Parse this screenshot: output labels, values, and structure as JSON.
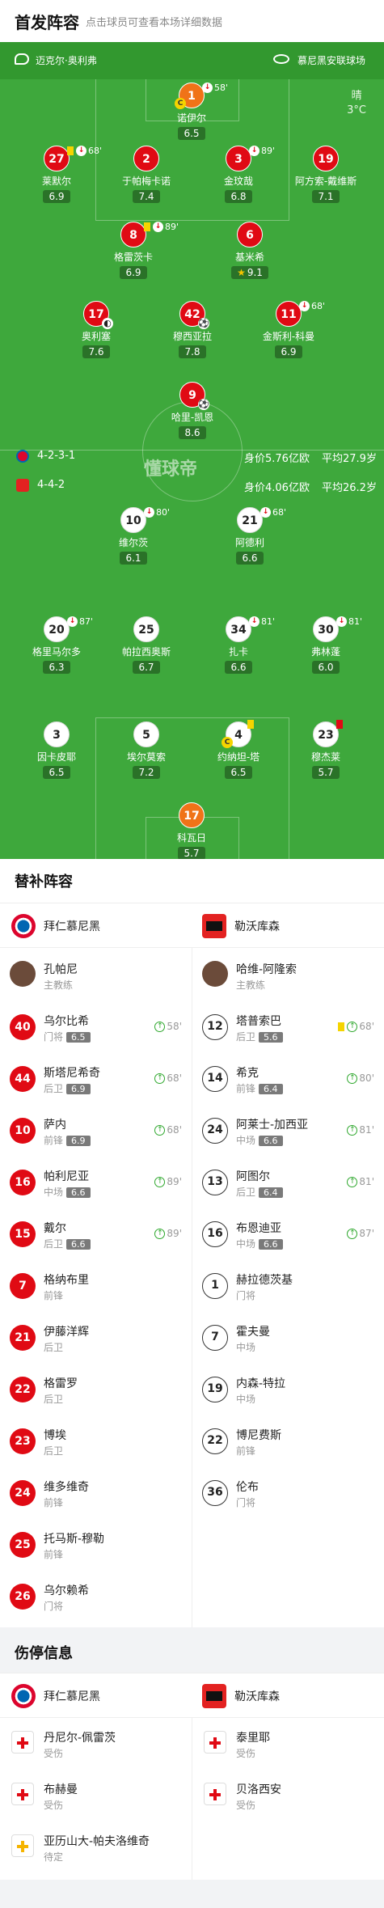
{
  "header": {
    "title": "首发阵容",
    "subtitle": "点击球员可查看本场详细数据"
  },
  "pitch": {
    "referee": "迈克尔·奥利弗",
    "stadium": "慕尼黑安联球场",
    "weather": "晴",
    "temperature": "3°C",
    "watermark": "懂球帝",
    "home_formation": "4-2-3-1",
    "away_formation": "4-4-2",
    "home_value": "身价5.76亿欧",
    "home_age": "平均27.9岁",
    "away_value": "身价4.06亿欧",
    "away_age": "平均26.2岁"
  },
  "home_players": [
    {
      "num": "1",
      "name": "诺伊尔",
      "rating": "6.5",
      "sub": "58'",
      "captain": "C"
    },
    {
      "num": "27",
      "name": "莱默尔",
      "rating": "6.9",
      "sub": "68'"
    },
    {
      "num": "2",
      "name": "于帕梅卡诺",
      "rating": "7.4"
    },
    {
      "num": "3",
      "name": "金玟哉",
      "rating": "6.8",
      "sub": "89'"
    },
    {
      "num": "19",
      "name": "阿方索-戴维斯",
      "rating": "7.1"
    },
    {
      "num": "8",
      "name": "格雷茨卡",
      "rating": "6.9",
      "sub": "89'"
    },
    {
      "num": "6",
      "name": "基米希",
      "rating": "9.1"
    },
    {
      "num": "17",
      "name": "奥利塞",
      "rating": "7.6"
    },
    {
      "num": "42",
      "name": "穆西亚拉",
      "rating": "7.8"
    },
    {
      "num": "11",
      "name": "金斯利-科曼",
      "rating": "6.9",
      "sub": "68'"
    },
    {
      "num": "9",
      "name": "哈里-凯恩",
      "rating": "8.6"
    }
  ],
  "away_players": [
    {
      "num": "10",
      "name": "维尔茨",
      "rating": "6.1",
      "sub": "80'"
    },
    {
      "num": "21",
      "name": "阿德利",
      "rating": "6.6",
      "sub": "68'"
    },
    {
      "num": "20",
      "name": "格里马尔多",
      "rating": "6.3",
      "sub": "87'"
    },
    {
      "num": "25",
      "name": "帕拉西奥斯",
      "rating": "6.7"
    },
    {
      "num": "34",
      "name": "扎卡",
      "rating": "6.6",
      "sub": "81'"
    },
    {
      "num": "30",
      "name": "弗林蓬",
      "rating": "6.0",
      "sub": "81'"
    },
    {
      "num": "3",
      "name": "因卡皮耶",
      "rating": "6.5"
    },
    {
      "num": "5",
      "name": "埃尔莫索",
      "rating": "7.2"
    },
    {
      "num": "4",
      "name": "约纳坦-塔",
      "rating": "6.5",
      "captain": "C"
    },
    {
      "num": "23",
      "name": "穆杰莱",
      "rating": "5.7"
    },
    {
      "num": "17",
      "name": "科瓦日",
      "rating": "5.7"
    }
  ],
  "subs": {
    "title": "替补阵容",
    "home_team": "拜仁慕尼黑",
    "away_team": "勒沃库森",
    "home_coach": {
      "name": "孔帕尼",
      "role": "主教练"
    },
    "away_coach": {
      "name": "哈维-阿隆索",
      "role": "主教练"
    },
    "home": [
      {
        "num": "40",
        "name": "乌尔比希",
        "pos": "门将",
        "rating": "6.5",
        "time": "58'"
      },
      {
        "num": "44",
        "name": "斯塔尼希奇",
        "pos": "后卫",
        "rating": "6.9",
        "time": "68'"
      },
      {
        "num": "10",
        "name": "萨内",
        "pos": "前锋",
        "rating": "6.9",
        "time": "68'"
      },
      {
        "num": "16",
        "name": "帕利尼亚",
        "pos": "中场",
        "rating": "6.6",
        "time": "89'"
      },
      {
        "num": "15",
        "name": "戴尔",
        "pos": "后卫",
        "rating": "6.6",
        "time": "89'"
      },
      {
        "num": "7",
        "name": "格纳布里",
        "pos": "前锋"
      },
      {
        "num": "21",
        "name": "伊藤洋辉",
        "pos": "后卫"
      },
      {
        "num": "22",
        "name": "格雷罗",
        "pos": "后卫"
      },
      {
        "num": "23",
        "name": "博埃",
        "pos": "后卫"
      },
      {
        "num": "24",
        "name": "维多维奇",
        "pos": "前锋"
      },
      {
        "num": "25",
        "name": "托马斯-穆勒",
        "pos": "前锋"
      },
      {
        "num": "26",
        "name": "乌尔赖希",
        "pos": "门将"
      }
    ],
    "away": [
      {
        "num": "12",
        "name": "塔普索巴",
        "pos": "后卫",
        "rating": "5.6",
        "time": "68'"
      },
      {
        "num": "14",
        "name": "希克",
        "pos": "前锋",
        "rating": "6.4",
        "time": "80'"
      },
      {
        "num": "24",
        "name": "阿莱士-加西亚",
        "pos": "中场",
        "rating": "6.6",
        "time": "81'"
      },
      {
        "num": "13",
        "name": "阿图尔",
        "pos": "后卫",
        "rating": "6.4",
        "time": "81'"
      },
      {
        "num": "16",
        "name": "布恩迪亚",
        "pos": "中场",
        "rating": "6.6",
        "time": "87'"
      },
      {
        "num": "1",
        "name": "赫拉德茨基",
        "pos": "门将"
      },
      {
        "num": "7",
        "name": "霍夫曼",
        "pos": "中场"
      },
      {
        "num": "19",
        "name": "内森-特拉",
        "pos": "中场"
      },
      {
        "num": "22",
        "name": "博尼费斯",
        "pos": "前锋"
      },
      {
        "num": "36",
        "name": "伦布",
        "pos": "门将"
      }
    ]
  },
  "injuries": {
    "title": "伤停信息",
    "home_team": "拜仁慕尼黑",
    "away_team": "勒沃库森",
    "home": [
      {
        "name": "丹尼尔-佩雷茨",
        "status": "受伤"
      },
      {
        "name": "布赫曼",
        "status": "受伤"
      },
      {
        "name": "亚历山大-帕夫洛维奇",
        "status": "待定"
      }
    ],
    "away": [
      {
        "name": "泰里耶",
        "status": "受伤"
      },
      {
        "name": "贝洛西安",
        "status": "受伤"
      }
    ]
  }
}
